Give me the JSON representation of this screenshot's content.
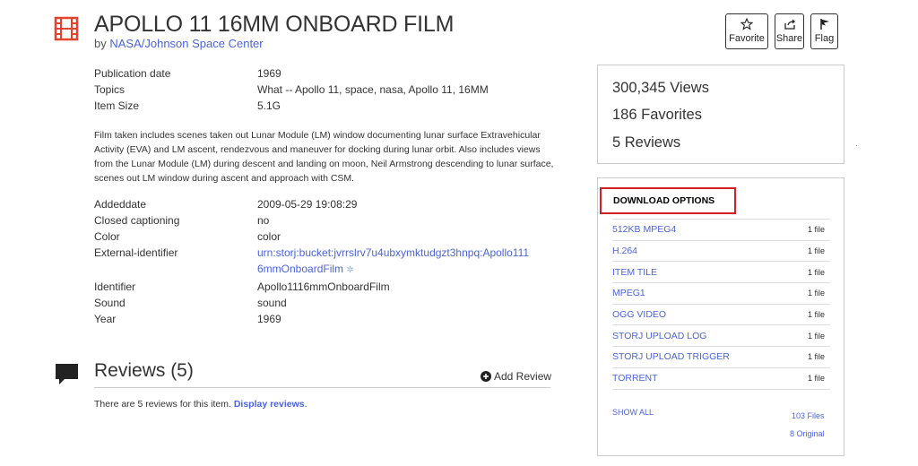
{
  "header": {
    "title": "APOLLO 11 16MM ONBOARD FILM",
    "by_prefix": "by ",
    "author": "NASA/Johnson Space Center",
    "actions": [
      {
        "label": "Favorite",
        "icon": "star-icon"
      },
      {
        "label": "Share",
        "icon": "share-icon"
      },
      {
        "label": "Flag",
        "icon": "flag-icon"
      }
    ]
  },
  "metadata_top": [
    {
      "key": "Publication date",
      "value": "1969"
    },
    {
      "key": "Topics",
      "value": "What -- Apollo 11, space, nasa, Apollo 11, 16MM"
    },
    {
      "key": "Item Size",
      "value": "5.1G"
    }
  ],
  "description": "Film taken includes scenes taken out Lunar Module (LM) window documenting lunar surface Extravehicular Activity (EVA) and LM ascent, rendezvous and maneuver for docking during lunar orbit. Also includes views from the Lunar Module (LM) during descent and landing on moon, Neil Armstrong descending to lunar surface, scenes out LM window during ascent and approach with CSM.",
  "metadata_bottom": [
    {
      "key": "Addeddate",
      "value": "2009-05-29 19:08:29"
    },
    {
      "key": "Closed captioning",
      "value": "no"
    },
    {
      "key": "Color",
      "value": "color"
    },
    {
      "key": "External-identifier",
      "value": "urn:storj:bucket:jvrrslrv7u4ubxymktudgzt3hnpq:Apollo111",
      "value2": "6mmOnboardFilm"
    },
    {
      "key": "Identifier",
      "value": "Apollo1116mmOnboardFilm"
    },
    {
      "key": "Sound",
      "value": "sound"
    },
    {
      "key": "Year",
      "value": "1969"
    }
  ],
  "reviews": {
    "title": "Reviews (5)",
    "add_label": "Add Review",
    "text_prefix": "There are 5 reviews for this item. ",
    "display_link": "Display reviews",
    "text_suffix": "."
  },
  "stats": {
    "views": "300,345 Views",
    "favorites": "186 Favorites",
    "reviews": "5 Reviews"
  },
  "downloads": {
    "title": "DOWNLOAD OPTIONS",
    "items": [
      {
        "name": "512KB MPEG4",
        "count": "1 file"
      },
      {
        "name": "H.264",
        "count": "1 file"
      },
      {
        "name": "ITEM TILE",
        "count": "1 file"
      },
      {
        "name": "MPEG1",
        "count": "1 file"
      },
      {
        "name": "OGG VIDEO",
        "count": "1 file"
      },
      {
        "name": "STORJ UPLOAD LOG",
        "count": "1 file"
      },
      {
        "name": "STORJ UPLOAD TRIGGER",
        "count": "1 file"
      },
      {
        "name": "TORRENT",
        "count": "1 file"
      }
    ],
    "show_all": "SHOW ALL",
    "total_files": "103 Files",
    "original": "8 Original"
  },
  "colors": {
    "link": "#4b64d7",
    "accent_red": "#d21f26",
    "film_icon": "#e0442a"
  }
}
